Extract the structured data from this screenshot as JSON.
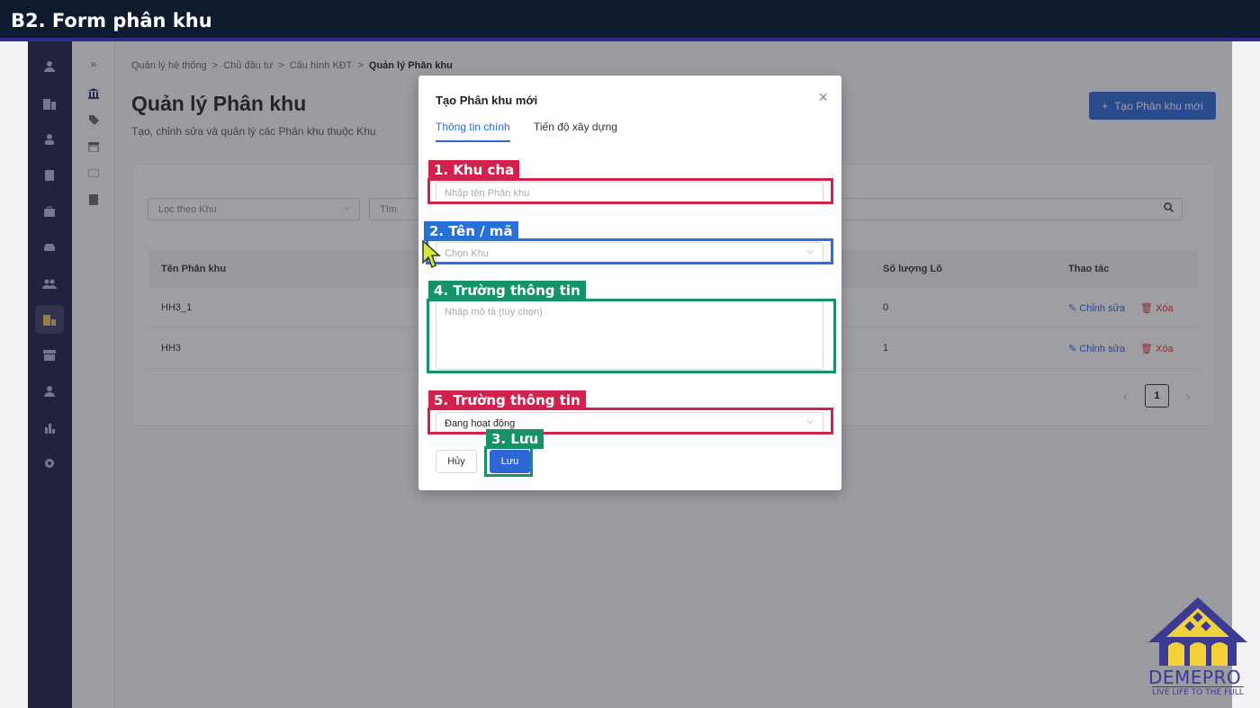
{
  "banner": {
    "title": "B2. Form phân khu"
  },
  "breadcrumb": {
    "items": [
      "Quản lý hệ thống",
      "Chủ đầu tư",
      "Cấu hình KĐT"
    ],
    "current": "Quản lý Phân khu",
    "separator": ">"
  },
  "page": {
    "title": "Quản lý Phân khu",
    "subtitle": "Tạo, chỉnh sửa và quản lý các Phân khu thuộc Khu",
    "create_button": "Tạo Phân khu mới"
  },
  "filters": {
    "area_placeholder": "Lọc theo Khu",
    "search_placeholder": "Tìm"
  },
  "table": {
    "columns": {
      "name": "Tên Phân khu",
      "count": "Số lượng Lô",
      "actions": "Thao tác"
    },
    "rows": [
      {
        "name": "HH3_1",
        "count": "0"
      },
      {
        "name": "HH3",
        "count": "1"
      }
    ],
    "edit_label": "Chỉnh sửa",
    "delete_label": "Xóa"
  },
  "pagination": {
    "current": "1",
    "prev": "‹",
    "next": "›"
  },
  "modal": {
    "title": "Tạo Phân khu mới",
    "close": "×",
    "tabs": [
      "Thông tin chính",
      "Tiến độ xây dựng"
    ],
    "name_placeholder": "Nhập tên Phân khu",
    "area_placeholder": "Chọn Khu",
    "description_placeholder": "Nhập mô tả (tùy chọn)",
    "status_value": "Đang hoạt động",
    "cancel": "Hủy",
    "save": "Lưu"
  },
  "annotations": {
    "a1": "1. Khu cha",
    "a2": "2. Tên / mã",
    "a3": "3. Lưu",
    "a4": "4. Trường thông tin",
    "a5": "5. Trường thông tin"
  },
  "logo": {
    "name": "DEMEPRO",
    "tagline": "LIVE LIFE TO THE FULL"
  },
  "colors": {
    "accent": "#2f66d6",
    "rail": "#1b1e47",
    "annotation_red": "#d1224e",
    "annotation_blue": "#2670d8",
    "annotation_green": "#14926a"
  }
}
